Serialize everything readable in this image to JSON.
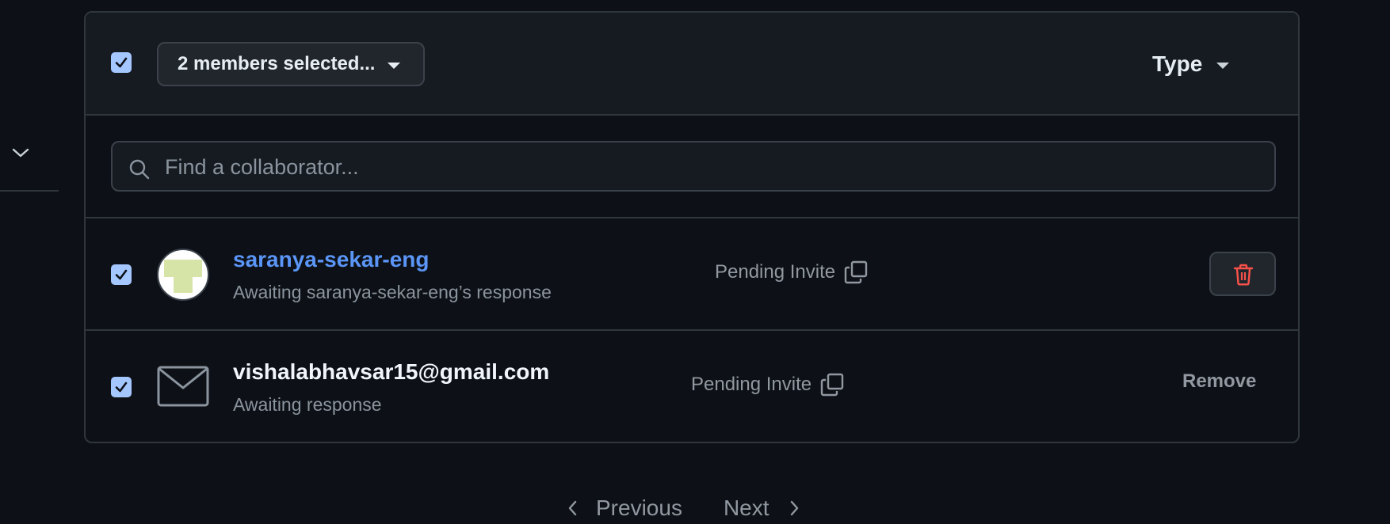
{
  "header": {
    "selection_label": "2 members selected...",
    "type_filter_label": "Type"
  },
  "search": {
    "placeholder": "Find a collaborator..."
  },
  "members": [
    {
      "name": "saranya-sekar-eng",
      "subtitle": "Awaiting saranya-sekar-eng’s response",
      "status": "Pending Invite",
      "action": "delete",
      "selected": true
    },
    {
      "name": "vishalabhavsar15@gmail.com",
      "subtitle": "Awaiting response",
      "status": "Pending Invite",
      "action_label": "Remove",
      "selected": true
    }
  ],
  "pagination": {
    "previous_label": "Previous",
    "next_label": "Next"
  },
  "icons": {
    "checkbox": "check-icon",
    "search": "search-icon",
    "copy": "copy-icon",
    "delete": "trash-icon",
    "email": "mail-icon",
    "sidebar": "chevron-down-icon"
  },
  "colors": {
    "background": "#0d1117",
    "panel_header": "#161b22",
    "border": "#30363d",
    "checkbox": "#a5c7ff",
    "link": "#5b95f6",
    "danger": "#f85149",
    "muted_text": "#8b949e"
  }
}
